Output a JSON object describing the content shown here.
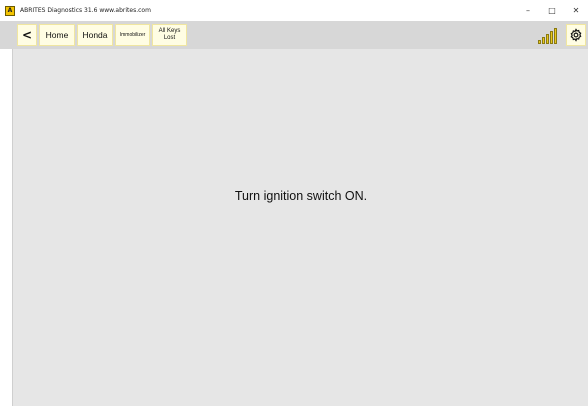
{
  "window": {
    "title": "ABRITES Diagnostics 31.6  www.abrites.com",
    "app_icon_glyph": "A",
    "controls": {
      "minimize": "–",
      "maximize": "□",
      "close": "✕"
    }
  },
  "toolbar": {
    "back_label": "<",
    "breadcrumbs": [
      {
        "label": "Home"
      },
      {
        "label": "Honda"
      },
      {
        "label": "Immobilizer"
      },
      {
        "label_line1": "All Keys",
        "label_line2": "Lost"
      }
    ],
    "signal_icon": "signal-strength-icon",
    "settings_icon": "gear-icon"
  },
  "main": {
    "message": "Turn ignition switch ON."
  },
  "colors": {
    "toolbar_bg": "#d7d7d7",
    "button_bg": "#fffde3",
    "content_bg": "#e6e6e6",
    "accent_yellow": "#e9c81e"
  }
}
